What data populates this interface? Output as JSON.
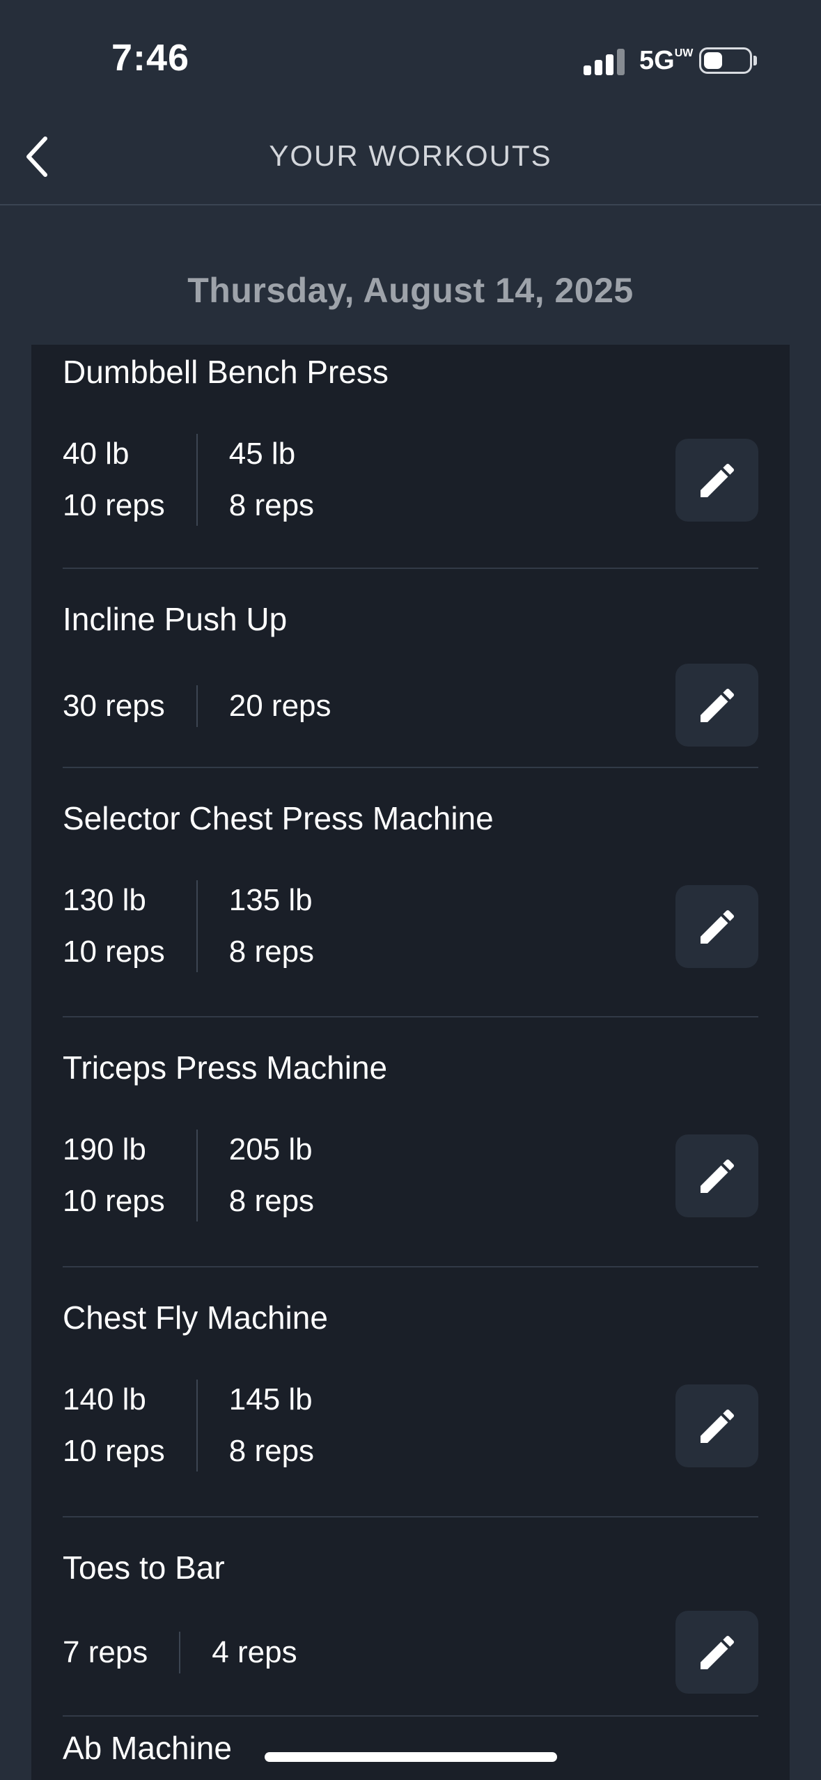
{
  "status_bar": {
    "time": "7:46",
    "network": "5G",
    "network_suffix": "UW"
  },
  "header": {
    "title": "YOUR WORKOUTS",
    "back_icon": "chevron-left-icon"
  },
  "date": "Thursday, August 14, 2025",
  "exercises": [
    {
      "name": "Dumbbell Bench Press",
      "sets": [
        {
          "weight": "40 lb",
          "reps": "10 reps"
        },
        {
          "weight": "45 lb",
          "reps": "8 reps"
        }
      ]
    },
    {
      "name": "Incline Push Up",
      "sets": [
        {
          "reps": "30 reps"
        },
        {
          "reps": "20 reps"
        }
      ]
    },
    {
      "name": "Selector Chest Press Machine",
      "sets": [
        {
          "weight": "130 lb",
          "reps": "10 reps"
        },
        {
          "weight": "135 lb",
          "reps": "8 reps"
        }
      ]
    },
    {
      "name": "Triceps Press Machine",
      "sets": [
        {
          "weight": "190 lb",
          "reps": "10 reps"
        },
        {
          "weight": "205 lb",
          "reps": "8 reps"
        }
      ]
    },
    {
      "name": "Chest Fly Machine",
      "sets": [
        {
          "weight": "140 lb",
          "reps": "10 reps"
        },
        {
          "weight": "145 lb",
          "reps": "8 reps"
        }
      ]
    },
    {
      "name": "Toes to Bar",
      "sets": [
        {
          "reps": "7 reps"
        },
        {
          "reps": "4 reps"
        }
      ]
    },
    {
      "name": "Ab Machine",
      "sets": []
    }
  ],
  "icons": {
    "edit": "pencil-icon"
  },
  "colors": {
    "background": "#262e3a",
    "card": "#1a1f28",
    "edit_button": "#262e3a"
  }
}
